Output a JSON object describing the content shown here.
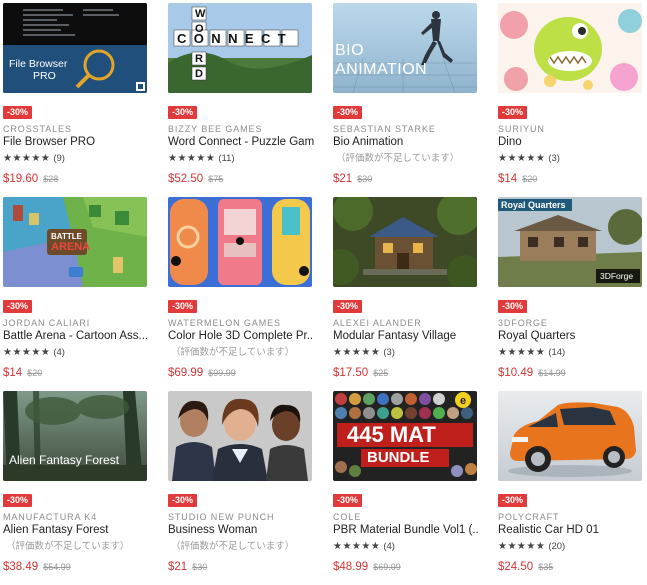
{
  "products": [
    {
      "badge": "-30%",
      "publisher": "CROSSTALES",
      "title": "File Browser PRO",
      "stars": "★★★★★",
      "count": "(9)",
      "no_rating": "",
      "price": "$19.60",
      "original": "$28",
      "thumb_text": [
        "File Browser",
        "PRO"
      ]
    },
    {
      "badge": "-30%",
      "publisher": "BIZZY BEE GAMES",
      "title": "Word Connect - Puzzle Game",
      "stars": "★★★★★",
      "count": "(11)",
      "no_rating": "",
      "price": "$52.50",
      "original": "$75",
      "thumb_text": [
        "W",
        "O",
        "R",
        "D",
        "CONNECT"
      ]
    },
    {
      "badge": "-30%",
      "publisher": "SEBASTIAN STARKE",
      "title": "Bio Animation",
      "stars": "",
      "count": "",
      "no_rating": "（評価数が不足しています）",
      "price": "$21",
      "original": "$30",
      "thumb_text": [
        "BIO",
        "ANIMATION"
      ]
    },
    {
      "badge": "-30%",
      "publisher": "SURIYUN",
      "title": "Dino",
      "stars": "★★★★★",
      "count": "(3)",
      "no_rating": "",
      "price": "$14",
      "original": "$20",
      "thumb_text": []
    },
    {
      "badge": "-30%",
      "publisher": "JORDAN CALIARI",
      "title": "Battle Arena - Cartoon Ass...",
      "stars": "★★★★★",
      "count": "(4)",
      "no_rating": "",
      "price": "$14",
      "original": "$20",
      "thumb_text": [
        "BATTLE",
        "ARENA"
      ]
    },
    {
      "badge": "-30%",
      "publisher": "WATERMELON GAMES",
      "title": "Color Hole 3D Complete Pr...",
      "stars": "",
      "count": "",
      "no_rating": "（評価数が不足しています）",
      "price": "$69.99",
      "original": "$99.99",
      "thumb_text": []
    },
    {
      "badge": "-30%",
      "publisher": "ALEXEI ALANDER",
      "title": "Modular Fantasy Village",
      "stars": "★★★★★",
      "count": "(3)",
      "no_rating": "",
      "price": "$17.50",
      "original": "$25",
      "thumb_text": []
    },
    {
      "badge": "-30%",
      "publisher": "3DFORGE",
      "title": "Royal Quarters",
      "stars": "★★★★★",
      "count": "(14)",
      "no_rating": "",
      "price": "$10.49",
      "original": "$14.99",
      "thumb_text": [
        "Royal Quarters",
        "3DForge"
      ]
    },
    {
      "badge": "-30%",
      "publisher": "MANUFACTURA K4",
      "title": "Alien Fantasy Forest",
      "stars": "",
      "count": "",
      "no_rating": "（評価数が不足しています）",
      "price": "$38.49",
      "original": "$54.99",
      "thumb_text": [
        "Alien Fantasy Forest"
      ]
    },
    {
      "badge": "-30%",
      "publisher": "STUDIO NEW PUNCH",
      "title": "Business Woman",
      "stars": "",
      "count": "",
      "no_rating": "（評価数が不足しています）",
      "price": "$21",
      "original": "$30",
      "thumb_text": []
    },
    {
      "badge": "-30%",
      "publisher": "COLE",
      "title": "PBR Material Bundle Vol1 (...",
      "stars": "★★★★★",
      "count": "(4)",
      "no_rating": "",
      "price": "$48.99",
      "original": "$69.99",
      "thumb_text": [
        "445 MAT",
        "BUNDLE"
      ]
    },
    {
      "badge": "-30%",
      "publisher": "POLYCRAFT",
      "title": "Realistic Car HD 01",
      "stars": "★★★★★",
      "count": "(20)",
      "no_rating": "",
      "price": "$24.50",
      "original": "$35",
      "thumb_text": []
    }
  ],
  "colors": {
    "badge": "#e23a3a",
    "price": "#d23535",
    "publisher": "#8c8c8c"
  }
}
